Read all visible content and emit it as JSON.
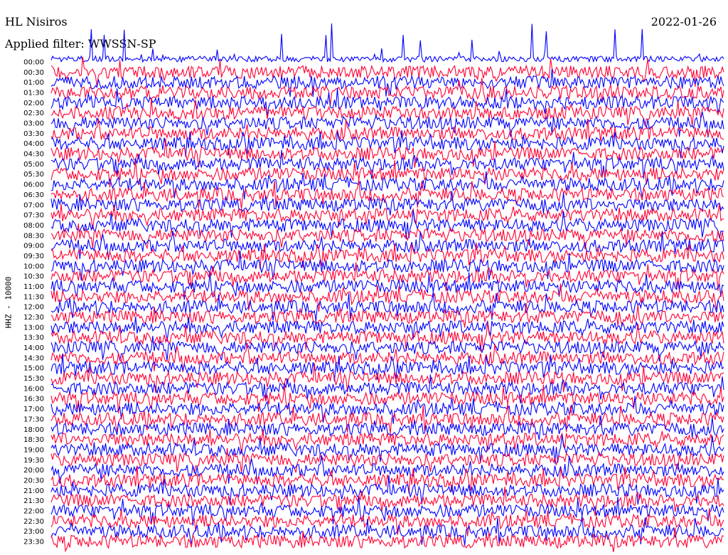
{
  "header": {
    "station": "HL Nisiros",
    "date": "2022-01-26",
    "filter": "Applied filter: WWSSN-SP"
  },
  "chart_data": {
    "type": "line",
    "title": "HL Nisiros",
    "subtitle": "Applied filter: WWSSN-SP",
    "date": "2022-01-26",
    "ylabel": "HHZ - 10000",
    "xlabel": "",
    "grid": false,
    "legend": "none",
    "row_labels": [
      "00:00",
      "00:30",
      "01:00",
      "01:30",
      "02:00",
      "02:30",
      "03:00",
      "03:30",
      "04:00",
      "04:30",
      "05:00",
      "05:30",
      "06:00",
      "06:30",
      "07:00",
      "07:30",
      "08:00",
      "08:30",
      "09:00",
      "09:30",
      "10:00",
      "10:30",
      "11:00",
      "11:30",
      "12:00",
      "12:30",
      "13:00",
      "13:30",
      "14:00",
      "14:30",
      "15:00",
      "15:30",
      "16:00",
      "16:30",
      "17:00",
      "17:30",
      "18:00",
      "18:30",
      "19:00",
      "19:30",
      "20:00",
      "20:30",
      "21:00",
      "21:30",
      "22:00",
      "22:30",
      "23:00",
      "23:30"
    ],
    "trace_colors": [
      "#0000ff",
      "#ff0033"
    ]
  }
}
